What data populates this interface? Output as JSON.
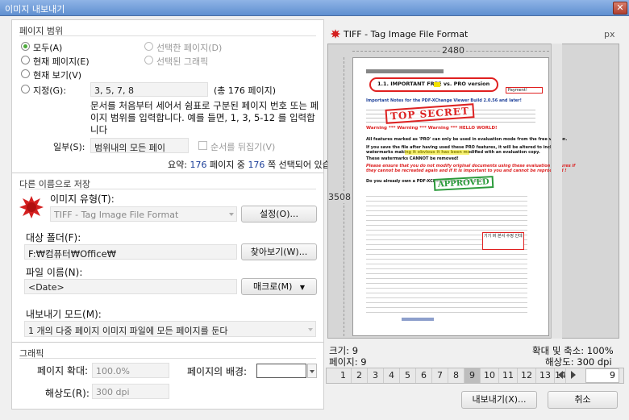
{
  "window": {
    "title": "이미지 내보내기",
    "close": "✕"
  },
  "range": {
    "section": "페이지 범위",
    "all": "모두(A)",
    "current_page": "현재 페이지(E)",
    "current_view": "현재 보기(V)",
    "specify": "지정(G):",
    "specify_value": "3, 5, 7, 8",
    "total_pages": "(총 176 페이지)",
    "selected_pages": "선택한 페이지(D)",
    "selected_graphics": "선택된 그래픽",
    "help": "문서를 처음부터 세어서 쉼표로 구분된 페이지 번호 또는 페이지 범위를 입력합니다. 예를 들면, 1, 3, 5-12 를 입력합니다",
    "subset_label": "일부(S):",
    "subset_value": "범위내의 모든 페이",
    "reverse": "순서를 뒤집기(V)",
    "summary_pre": "요약:",
    "summary_a": "176",
    "summary_mid": "페이지 중",
    "summary_b": "176",
    "summary_post": "쪽 선택되어 있습니다"
  },
  "saveas": {
    "section": "다른 이름으로 저장",
    "image_type_label": "이미지 유형(T):",
    "image_type_value": "TIFF - Tag Image File Format",
    "settings_button": "설정(O)...",
    "folder_label": "대상 폴더(F):",
    "folder_value": "F:₩컴퓨터₩Office₩",
    "browse_button": "찾아보기(W)...",
    "filename_label": "파일 이름(N):",
    "filename_value": "<Date>",
    "macro_button": "매크로(M)",
    "mode_label": "내보내기 모드(M):",
    "mode_value": "1 개의 다중 페이지 이미지 파일에 모든 페이지를 둔다"
  },
  "graphics": {
    "section": "그래픽",
    "zoom_label": "페이지 확대:",
    "zoom_value": "100.0%",
    "bg_label": "페이지의 배경:",
    "res_label": "해상도(R):",
    "res_value": "300 dpi"
  },
  "preview": {
    "title": "TIFF - Tag Image File Format",
    "unit": "px",
    "width": "2480",
    "height": "3508",
    "size": "크기: 9",
    "pages": "페이지: 9",
    "scale": "확대 및 축소: 100%",
    "dpi": "해상도: 300 dpi",
    "doc": {
      "h1": "1.1.      IMPORTANT FREE vs. PRO version",
      "l1": "Important Notes for the PDF-XChange Viewer Build 2.0.56 and later!",
      "stamp1": "TOP SECRET",
      "warn": "Warning *** Warning *** Warning ***  HELLO WORLD!",
      "p1": "All features marked as 'PRO' can only be used in evaluation mode from the free version.",
      "p2": "If you save the file after having used these PRO features, it will be altered to include",
      "p3": "watermarks making it obvious it has been modified with an evaluation copy.",
      "p4": "These watermarks CANNOT be removed!",
      "p5": "Please ensure that you do not modify original documents using these evaluation features if",
      "p6": "they cannot be recreated again and if it is important to you and cannot be reproduced !",
      "p7": "Do you already own a PDF-XChange Viewer license?",
      "stamp2": "APPROVED",
      "callout": "Payment!",
      "memo": "기기 버 본서 수정 인데"
    }
  },
  "pager": {
    "pages": [
      "1",
      "2",
      "3",
      "4",
      "5",
      "6",
      "7",
      "8",
      "9",
      "10",
      "11",
      "12",
      "13",
      "14"
    ],
    "active": "9",
    "goto": "9"
  },
  "buttons": {
    "export": "내보내기(X)...",
    "cancel": "취소"
  },
  "colors": {
    "accent": "#4caa3a",
    "link": "#1c3f99",
    "red": "#d22"
  }
}
